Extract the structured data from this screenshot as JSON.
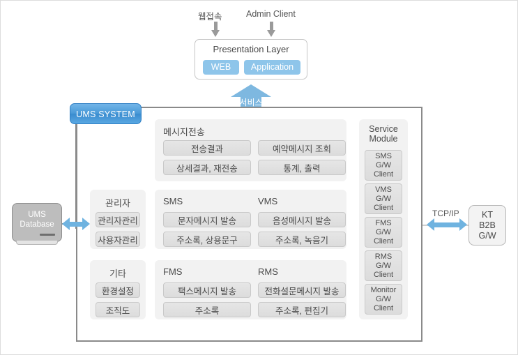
{
  "top": {
    "web_access_label": "웹접속",
    "admin_client_label": "Admin Client"
  },
  "presentation": {
    "title": "Presentation Layer",
    "chips": [
      {
        "label": "WEB"
      },
      {
        "label": "Application"
      }
    ]
  },
  "service_arrow": {
    "label": "서비스"
  },
  "ums_panel": {
    "badge": "UMS SYSTEM"
  },
  "groups": {
    "message": {
      "title": "메시지전송",
      "items": [
        {
          "label": "전송결과"
        },
        {
          "label": "예약메시지 조회"
        },
        {
          "label": "상세결과, 재전송"
        },
        {
          "label": "통계, 출력"
        }
      ]
    },
    "admin": {
      "title": "관리자",
      "items": [
        {
          "label": "관리자관리"
        },
        {
          "label": "사용자관리"
        }
      ]
    },
    "sms": {
      "title": "SMS",
      "items": [
        {
          "label": "문자메시지 발송"
        },
        {
          "label": "주소록, 상용문구"
        }
      ]
    },
    "vms": {
      "title": "VMS",
      "items": [
        {
          "label": "음성메시지 발송"
        },
        {
          "label": "주소록, 녹음기"
        }
      ]
    },
    "etc": {
      "title": "기타",
      "items": [
        {
          "label": "환경설정"
        },
        {
          "label": "조직도"
        }
      ]
    },
    "fms": {
      "title": "FMS",
      "items": [
        {
          "label": "팩스메시지 발송"
        },
        {
          "label": "주소록"
        }
      ]
    },
    "rms": {
      "title": "RMS",
      "items": [
        {
          "label": "전화설문메시지 발송"
        },
        {
          "label": "주소록, 편집기"
        }
      ]
    },
    "service_module": {
      "title": "Service Module",
      "items": [
        {
          "line1": "SMS",
          "line2": "G/W",
          "line3": "Client"
        },
        {
          "line1": "VMS",
          "line2": "G/W",
          "line3": "Client"
        },
        {
          "line1": "FMS",
          "line2": "G/W",
          "line3": "Client"
        },
        {
          "line1": "RMS",
          "line2": "G/W",
          "line3": "Client"
        },
        {
          "line1": "Monitor",
          "line2": "G/W",
          "line3": "Client"
        }
      ]
    }
  },
  "database": {
    "line1": "UMS",
    "line2": "Database"
  },
  "gateway": {
    "protocol_label": "TCP/IP",
    "line1": "KT",
    "line2": "B2B",
    "line3": "G/W"
  },
  "colors": {
    "accent_blue": "#6fb3e0",
    "chip_blue": "#8ec5ea",
    "badge_blue": "#4a9ad8",
    "panel_border": "#8a8a8a",
    "group_bg": "#f2f2f2",
    "item_bg": "#e0e0e0",
    "db_grey": "#bdbdbd"
  }
}
